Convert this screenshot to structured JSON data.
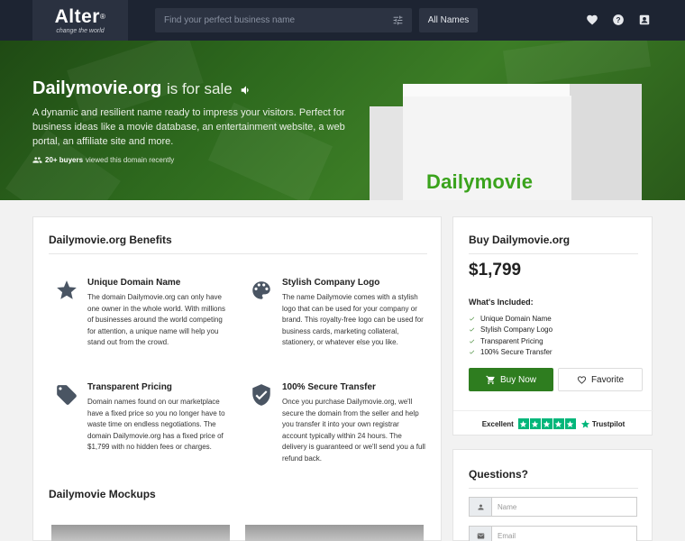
{
  "brand": {
    "logo": "Alter",
    "logo_mark": "®",
    "tagline": "change the world"
  },
  "nav": {
    "search_placeholder": "Find your perfect business name",
    "all_names": "All Names",
    "icons": [
      "heart-icon",
      "help-icon",
      "account-icon"
    ]
  },
  "hero": {
    "domain": "Dailymovie.org",
    "for_sale": "is for sale",
    "description": "A dynamic and resilient name ready to impress your visitors. Perfect for business ideas like a movie database, an entertainment website, a web portal, an affiliate site and more.",
    "buyers_count": "20+ buyers",
    "buyers_text": "viewed this domain recently",
    "box_brand": "Dailymovie"
  },
  "benefits": {
    "title": "Dailymovie.org Benefits",
    "items": [
      {
        "icon": "star-icon",
        "title": "Unique Domain Name",
        "text": "The domain Dailymovie.org can only have one owner in the whole world. With millions of businesses around the world competing for attention, a unique name will help you stand out from the crowd."
      },
      {
        "icon": "palette-icon",
        "title": "Stylish Company Logo",
        "text": "The name Dailymovie comes with a stylish logo that can be used for your company or brand. This royalty-free logo can be used for business cards, marketing collateral, stationery, or whatever else you like."
      },
      {
        "icon": "price-tag-icon",
        "title": "Transparent Pricing",
        "text": "Domain names found on our marketplace have a fixed price so you no longer have to waste time on endless negotiations. The domain Dailymovie.org has a fixed price of $1,799 with no hidden fees or charges."
      },
      {
        "icon": "shield-check-icon",
        "title": "100% Secure Transfer",
        "text": "Once you purchase Dailymovie.org, we'll secure the domain from the seller and help you transfer it into your own registrar account typically within 24 hours. The delivery is guaranteed or we'll send you a full refund back."
      }
    ],
    "mockups_title": "Dailymovie Mockups"
  },
  "buy": {
    "title": "Buy Dailymovie.org",
    "price": "$1,799",
    "included_title": "What's Included:",
    "included": [
      "Unique Domain Name",
      "Stylish Company Logo",
      "Transparent Pricing",
      "100% Secure Transfer"
    ],
    "buy_now": "Buy Now",
    "favorite": "Favorite",
    "trustpilot_label": "Excellent",
    "trustpilot_brand": "Trustpilot",
    "trustpilot_stars": 5,
    "accent_color": "#2e7d1f",
    "trustpilot_color": "#00b67a"
  },
  "questions": {
    "title": "Questions?",
    "name_placeholder": "Name",
    "email_placeholder": "Email"
  }
}
